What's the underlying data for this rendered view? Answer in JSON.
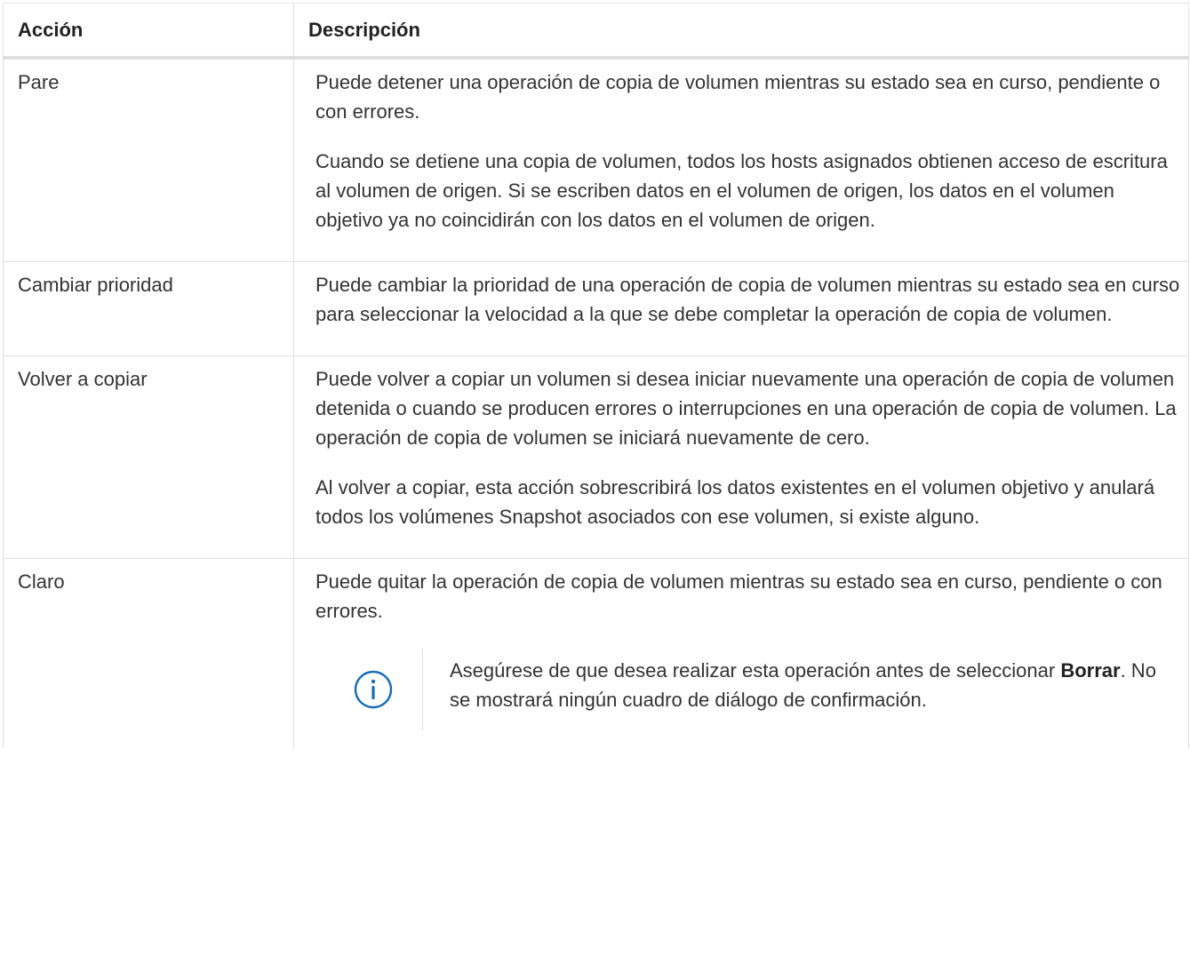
{
  "table": {
    "headers": {
      "action": "Acción",
      "description": "Descripción"
    },
    "rows": [
      {
        "action": "Pare",
        "paragraphs": [
          "Puede detener una operación de copia de volumen mientras su estado sea en curso, pendiente o con errores.",
          "Cuando se detiene una copia de volumen, todos los hosts asignados obtienen acceso de escritura al volumen de origen. Si se escriben datos en el volumen de origen, los datos en el volumen objetivo ya no coincidirán con los datos en el volumen de origen."
        ]
      },
      {
        "action": "Cambiar prioridad",
        "paragraphs": [
          "Puede cambiar la prioridad de una operación de copia de volumen mientras su estado sea en curso para seleccionar la velocidad a la que se debe completar la operación de copia de volumen."
        ]
      },
      {
        "action": "Volver a copiar",
        "paragraphs": [
          "Puede volver a copiar un volumen si desea iniciar nuevamente una operación de copia de volumen detenida o cuando se producen errores o interrupciones en una operación de copia de volumen. La operación de copia de volumen se iniciará nuevamente de cero.",
          "Al volver a copiar, esta acción sobrescribirá los datos existentes en el volumen objetivo y anulará todos los volúmenes Snapshot asociados con ese volumen, si existe alguno."
        ]
      },
      {
        "action": "Claro",
        "paragraphs": [
          "Puede quitar la operación de copia de volumen mientras su estado sea en curso, pendiente o con errores."
        ],
        "note": {
          "icon": "info-icon",
          "text_before": "Asegúrese de que desea realizar esta operación antes de seleccionar ",
          "bold": "Borrar",
          "text_after": ". No se mostrará ningún cuadro de diálogo de confirmación."
        }
      }
    ]
  },
  "colors": {
    "info_icon": "#1a6eb5",
    "border": "#dddddd",
    "text": "#333333"
  }
}
